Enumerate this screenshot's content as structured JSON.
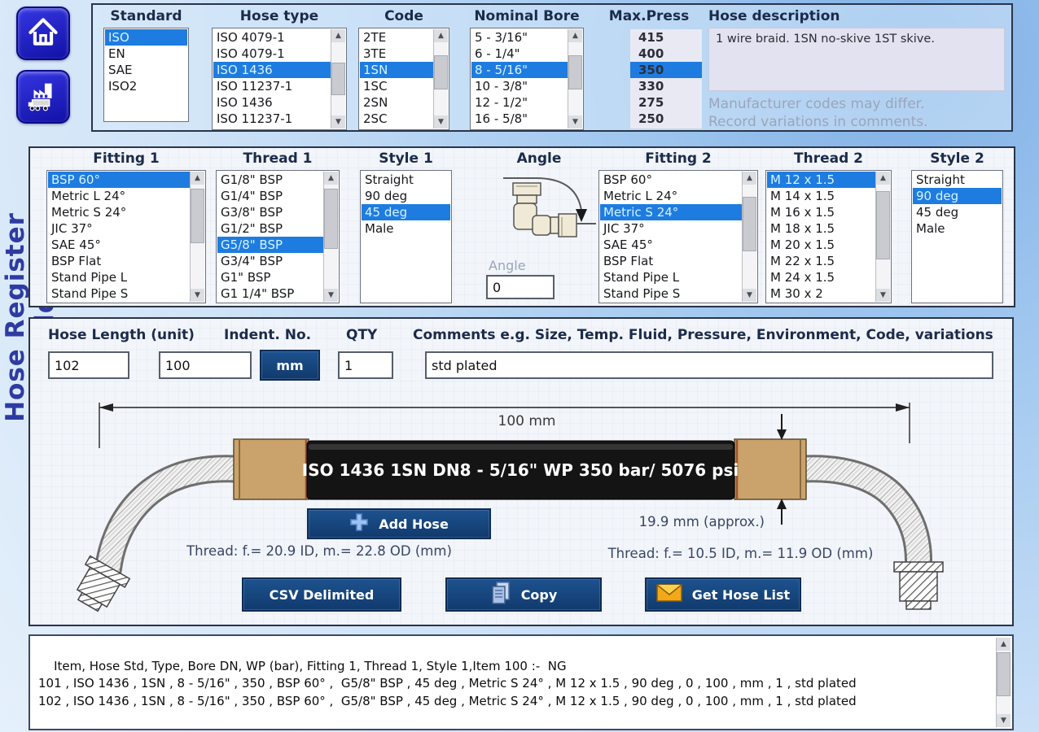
{
  "app": {
    "title": "Hose Register Builder"
  },
  "nav": {
    "home_icon": "home",
    "factory_icon": "factory-truck"
  },
  "standards_panel": {
    "standard": {
      "label": "Standard",
      "items": [
        "ISO",
        "EN",
        "SAE",
        "ISO2"
      ],
      "selected_index": 0
    },
    "hose_type": {
      "label": "Hose type",
      "items": [
        "ISO 4079-1",
        "ISO 4079-1",
        "ISO 1436",
        "ISO 11237-1",
        "ISO 1436",
        "ISO 11237-1"
      ],
      "selected_index": 2
    },
    "code": {
      "label": "Code",
      "items": [
        "2TE",
        "3TE",
        "1SN",
        "1SC",
        "2SN",
        "2SC"
      ],
      "selected_index": 2
    },
    "nominal_bore": {
      "label": "Nominal Bore",
      "items": [
        "5 - 3/16\"",
        "6 - 1/4\"",
        "8 - 5/16\"",
        "10 - 3/8\"",
        "12 - 1/2\"",
        "16 - 5/8\""
      ],
      "selected_index": 2
    },
    "max_press": {
      "label": "Max.Press",
      "items": [
        "415",
        "400",
        "350",
        "330",
        "275",
        "250"
      ],
      "selected_index": 2
    },
    "description": {
      "label": "Hose description",
      "value": "1 wire braid. 1SN no-skive 1ST skive.",
      "note1": "Manufacturer codes may differ.",
      "note2": "Record variations in comments."
    }
  },
  "fittings_panel": {
    "fitting1": {
      "label": "Fitting 1",
      "items": [
        "BSP 60°",
        "Metric L 24°",
        "Metric S 24°",
        "JIC 37°",
        "SAE 45°",
        "BSP Flat",
        "Stand Pipe L",
        "Stand Pipe S"
      ],
      "selected_index": 0
    },
    "thread1": {
      "label": "Thread 1",
      "items": [
        "G1/8\" BSP",
        "G1/4\" BSP",
        "G3/8\" BSP",
        "G1/2\" BSP",
        "G5/8\" BSP",
        "G3/4\" BSP",
        "G1\" BSP",
        "G1 1/4\" BSP"
      ],
      "selected_index": 4
    },
    "style1": {
      "label": "Style 1",
      "items": [
        "Straight",
        "90 deg",
        "45 deg",
        "Male"
      ],
      "selected_index": 2
    },
    "angle": {
      "label": "Angle",
      "field_label": "Angle",
      "value": "0"
    },
    "fitting2": {
      "label": "Fitting 2",
      "items": [
        "BSP 60°",
        "Metric L 24°",
        "Metric S 24°",
        "JIC 37°",
        "SAE 45°",
        "BSP Flat",
        "Stand Pipe L",
        "Stand Pipe S"
      ],
      "selected_index": 2
    },
    "thread2": {
      "label": "Thread 2",
      "items": [
        "M 12 x 1.5",
        "M 14 x 1.5",
        "M 16 x 1.5",
        "M 18 x 1.5",
        "M 20 x 1.5",
        "M 22 x 1.5",
        "M 24 x 1.5",
        "M 30 x 2"
      ],
      "selected_index": 0
    },
    "style2": {
      "label": "Style 2",
      "items": [
        "Straight",
        "90 deg",
        "45 deg",
        "Male"
      ],
      "selected_index": 1
    }
  },
  "builder_panel": {
    "hose_length": {
      "label": "Hose Length (unit)",
      "value": "102"
    },
    "indent_no": {
      "label": "Indent. No.",
      "value": "100"
    },
    "unit_button_label": "mm",
    "qty": {
      "label": "QTY",
      "value": "1"
    },
    "comments": {
      "label": "Comments e.g. Size, Temp. Fluid, Pressure, Environment, Code, variations",
      "value": "std plated"
    },
    "diagram": {
      "dimension_label": "100 mm",
      "band_text": "ISO 1436 1SN DN8 - 5/16\" WP 350 bar/ 5076 psi",
      "od_label": "19.9 mm (approx.)",
      "thread1_info": "Thread: f.= 20.9 ID, m.= 22.8 OD (mm)",
      "thread2_info": "Thread: f.= 10.5 ID, m.= 11.9 OD (mm)"
    },
    "add_hose_button": "Add Hose",
    "csv_button": "CSV Delimited",
    "copy_button": "Copy",
    "get_hose_list_button": "Get Hose List"
  },
  "output": {
    "text": "Item, Hose Std, Type, Bore DN, WP (bar), Fitting 1, Thread 1, Style 1,Item 100 :-  NG\n101 , ISO 1436 , 1SN , 8 - 5/16\" , 350 , BSP 60° ,  G5/8\" BSP , 45 deg , Metric S 24° , M 12 x 1.5 , 90 deg , 0 , 100 , mm , 1 , std plated\n102 , ISO 1436 , 1SN , 8 - 5/16\" , 350 , BSP 60° ,  G5/8\" BSP , 45 deg , Metric S 24° , M 12 x 1.5 , 90 deg , 0 , 100 , mm , 1 , std plated"
  },
  "colors": {
    "selection_blue": "#1e7ce0",
    "button_navy": "#15427c",
    "ferrule_tan": "#c9a36b",
    "nav_button_blue": "#2222cc",
    "envelope_yellow": "#f2a818"
  }
}
